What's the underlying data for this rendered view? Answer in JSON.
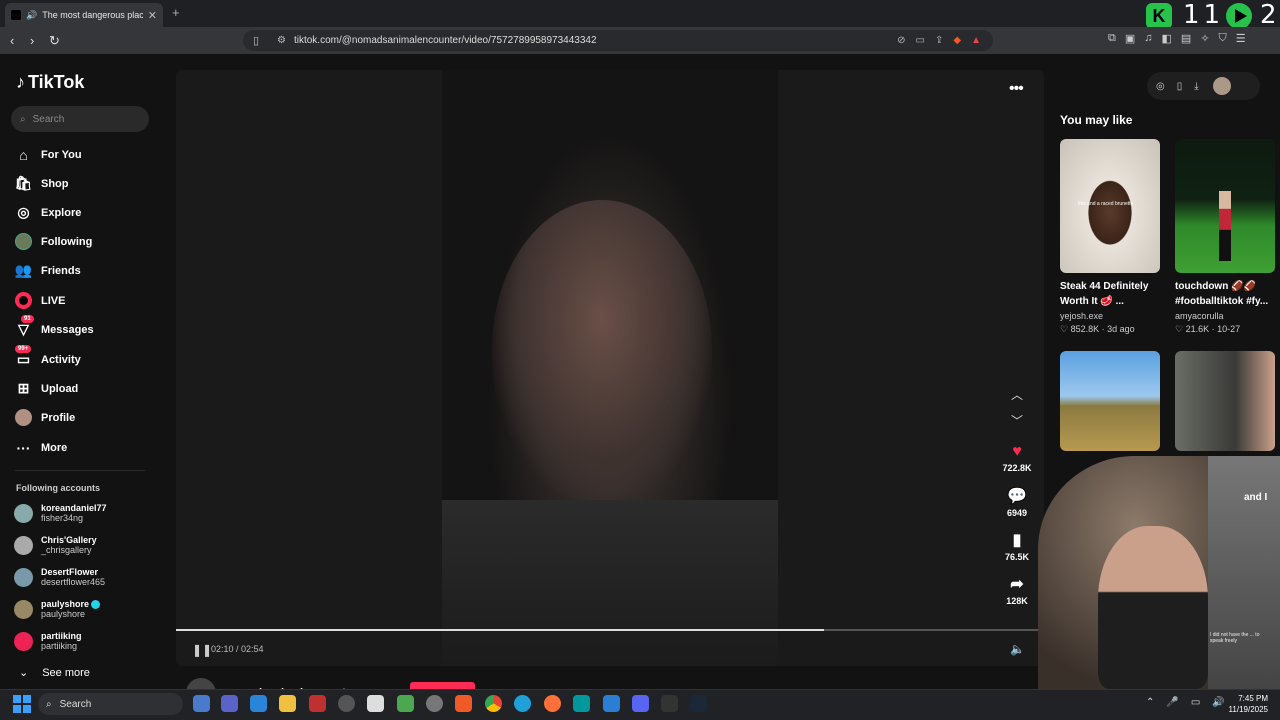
{
  "browser": {
    "tab_title": "The most dangerous place in",
    "new_tab": "+",
    "url": "tiktok.com/@nomadsanimalencounter/video/7572789958973443342",
    "overlay_k": "K",
    "overlay_num1": "11",
    "overlay_num2": "2"
  },
  "brand": {
    "name": "TikTok",
    "accent": "#fe2c55"
  },
  "search": {
    "placeholder": "Search"
  },
  "nav": [
    {
      "label": "For You",
      "icon": "home-icon"
    },
    {
      "label": "Shop",
      "icon": "shop-icon"
    },
    {
      "label": "Explore",
      "icon": "compass-icon"
    },
    {
      "label": "Following",
      "icon": "following-avatar-icon"
    },
    {
      "label": "Friends",
      "icon": "friends-icon"
    },
    {
      "label": "LIVE",
      "icon": "live-icon"
    },
    {
      "label": "Messages",
      "icon": "messages-icon",
      "badge": "91"
    },
    {
      "label": "Activity",
      "icon": "activity-icon",
      "badge": "99+"
    },
    {
      "label": "Upload",
      "icon": "upload-icon"
    },
    {
      "label": "Profile",
      "icon": "profile-avatar-icon"
    },
    {
      "label": "More",
      "icon": "more-icon"
    }
  ],
  "following_accounts": {
    "title": "Following accounts",
    "items": [
      {
        "name": "koreandaniel77",
        "handle": "fisher34ng"
      },
      {
        "name": "Chris'Gallery",
        "handle": "_chrisgallery"
      },
      {
        "name": "DesertFlower",
        "handle": "desertflower465"
      },
      {
        "name": "paulyshore",
        "handle": "paulyshore",
        "verified": true
      },
      {
        "name": "partiiking",
        "handle": "partiiking"
      }
    ],
    "see_more": "See more"
  },
  "player": {
    "time": "02:10 / 02:54",
    "progress": 0.747,
    "author": "nomadsanimalencounter",
    "likes": "722.8K",
    "comments": "6949",
    "saves": "76.5K",
    "shares": "128K"
  },
  "you_may_like": {
    "title": "You may like",
    "cards": [
      {
        "title": "Steak 44 Definitely Worth It 🥩 ...",
        "author": "yejosh.exe",
        "meta": "852.8K · 3d ago",
        "thumb_caption": "this and a raced brunette"
      },
      {
        "title": "touchdown 🏈🏈 #footballtiktok #fy...",
        "author": "amyacorulla",
        "meta": "21.6K · 10-27"
      }
    ]
  },
  "webcam_overlay": {
    "text": "and I",
    "small_text": "I did not have the ... to speak freely"
  },
  "taskbar": {
    "search": "Search",
    "time": "7:45 PM",
    "date": "11/19/2025"
  }
}
